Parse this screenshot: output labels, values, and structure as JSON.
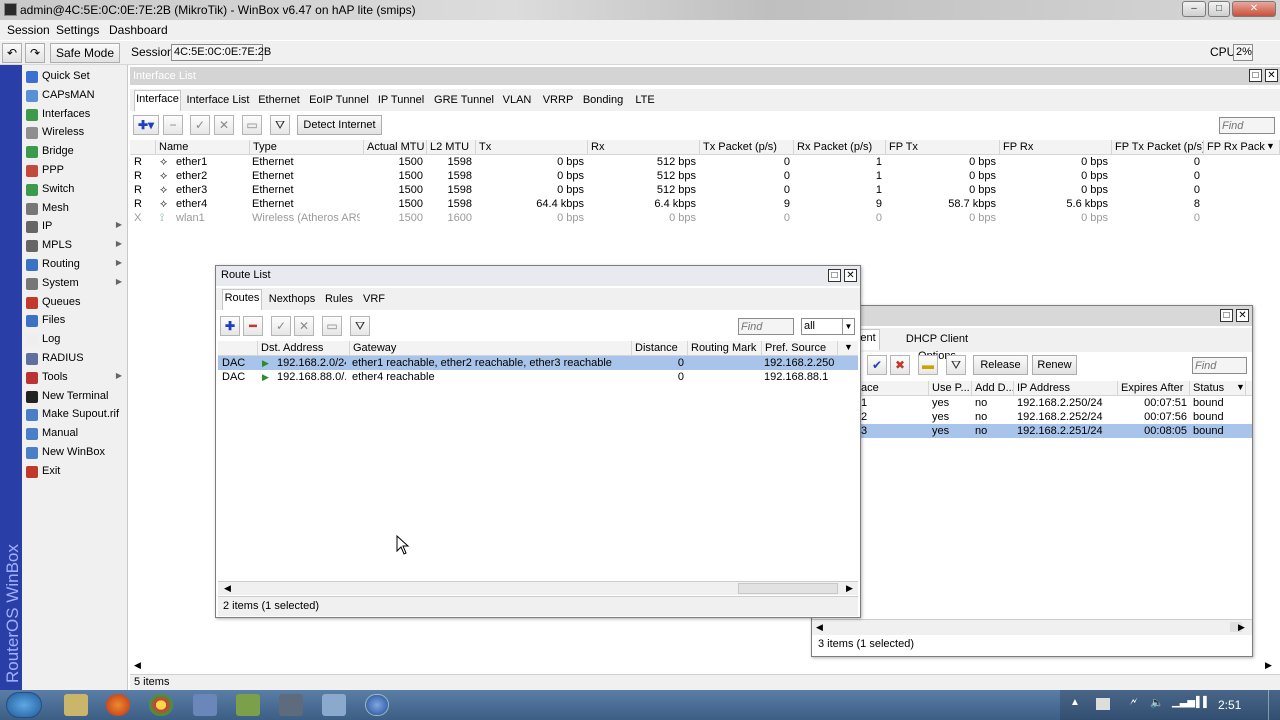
{
  "window": {
    "title": "admin@4C:5E:0C:0E:7E:2B (MikroTik) - WinBox v6.47 on hAP lite (smips)"
  },
  "menu": [
    "Session",
    "Settings",
    "Dashboard"
  ],
  "toolbar": {
    "safe_mode": "Safe Mode",
    "session_label": "Session:",
    "session_value": "4C:5E:0C:0E:7E:2B",
    "cpu_label": "CPU:",
    "cpu_value": "2%"
  },
  "strip_text": "RouterOS WinBox",
  "sidebar": [
    {
      "label": "Quick Set",
      "icon": "quickset-icon",
      "color": "#3b6fd4",
      "sub": false
    },
    {
      "label": "CAPsMAN",
      "icon": "capsman-icon",
      "color": "#5a8fd8",
      "sub": false
    },
    {
      "label": "Interfaces",
      "icon": "interfaces-icon",
      "color": "#3d9a4d",
      "sub": false
    },
    {
      "label": "Wireless",
      "icon": "wireless-icon",
      "color": "#8e8e8e",
      "sub": false
    },
    {
      "label": "Bridge",
      "icon": "bridge-icon",
      "color": "#3d9a4d",
      "sub": false
    },
    {
      "label": "PPP",
      "icon": "ppp-icon",
      "color": "#c24a3a",
      "sub": false
    },
    {
      "label": "Switch",
      "icon": "switch-icon",
      "color": "#3d9a4d",
      "sub": false
    },
    {
      "label": "Mesh",
      "icon": "mesh-icon",
      "color": "#777777",
      "sub": false
    },
    {
      "label": "IP",
      "icon": "ip-icon",
      "color": "#666666",
      "sub": true
    },
    {
      "label": "MPLS",
      "icon": "mpls-icon",
      "color": "#666666",
      "sub": true
    },
    {
      "label": "Routing",
      "icon": "routing-icon",
      "color": "#3a73c4",
      "sub": true
    },
    {
      "label": "System",
      "icon": "system-icon",
      "color": "#777777",
      "sub": true
    },
    {
      "label": "Queues",
      "icon": "queues-icon",
      "color": "#c0392b",
      "sub": false
    },
    {
      "label": "Files",
      "icon": "files-icon",
      "color": "#3a73c4",
      "sub": false
    },
    {
      "label": "Log",
      "icon": "log-icon",
      "color": "#eeeeee",
      "sub": false
    },
    {
      "label": "RADIUS",
      "icon": "radius-icon",
      "color": "#5e6fa0",
      "sub": false
    },
    {
      "label": "Tools",
      "icon": "tools-icon",
      "color": "#b33",
      "sub": true
    },
    {
      "label": "New Terminal",
      "icon": "terminal-icon",
      "color": "#222222",
      "sub": false
    },
    {
      "label": "Make Supout.rif",
      "icon": "supout-icon",
      "color": "#4a7fc8",
      "sub": false
    },
    {
      "label": "Manual",
      "icon": "manual-icon",
      "color": "#4a7fc8",
      "sub": false
    },
    {
      "label": "New WinBox",
      "icon": "winbox-icon",
      "color": "#4a7fc8",
      "sub": false
    },
    {
      "label": "Exit",
      "icon": "exit-icon",
      "color": "#c0392b",
      "sub": false
    }
  ],
  "interface_list": {
    "title": "Interface List",
    "tabs": [
      "Interface",
      "Interface List",
      "Ethernet",
      "EoIP Tunnel",
      "IP Tunnel",
      "GRE Tunnel",
      "VLAN",
      "VRRP",
      "Bonding",
      "LTE"
    ],
    "detect_internet": "Detect Internet",
    "find_placeholder": "Find",
    "columns": [
      "Name",
      "Type",
      "Actual MTU",
      "L2 MTU",
      "Tx",
      "Rx",
      "Tx Packet (p/s)",
      "Rx Packet (p/s)",
      "FP Tx",
      "FP Rx",
      "FP Tx Packet (p/s)",
      "FP Rx Pack"
    ],
    "rows": [
      {
        "flag": "R",
        "name": "ether1",
        "type": "Ethernet",
        "mtu": "1500",
        "l2mtu": "1598",
        "tx": "0 bps",
        "rx": "512 bps",
        "txp": "0",
        "rxp": "1",
        "fptx": "0 bps",
        "fprx": "0 bps",
        "fptxp": "0",
        "disabled": false
      },
      {
        "flag": "R",
        "name": "ether2",
        "type": "Ethernet",
        "mtu": "1500",
        "l2mtu": "1598",
        "tx": "0 bps",
        "rx": "512 bps",
        "txp": "0",
        "rxp": "1",
        "fptx": "0 bps",
        "fprx": "0 bps",
        "fptxp": "0",
        "disabled": false
      },
      {
        "flag": "R",
        "name": "ether3",
        "type": "Ethernet",
        "mtu": "1500",
        "l2mtu": "1598",
        "tx": "0 bps",
        "rx": "512 bps",
        "txp": "0",
        "rxp": "1",
        "fptx": "0 bps",
        "fprx": "0 bps",
        "fptxp": "0",
        "disabled": false
      },
      {
        "flag": "R",
        "name": "ether4",
        "type": "Ethernet",
        "mtu": "1500",
        "l2mtu": "1598",
        "tx": "64.4 kbps",
        "rx": "6.4 kbps",
        "txp": "9",
        "rxp": "9",
        "fptx": "58.7 kbps",
        "fprx": "5.6 kbps",
        "fptxp": "8",
        "disabled": false
      },
      {
        "flag": "X",
        "name": "wlan1",
        "type": "Wireless (Atheros AR9...",
        "mtu": "1500",
        "l2mtu": "1600",
        "tx": "0 bps",
        "rx": "0 bps",
        "txp": "0",
        "rxp": "0",
        "fptx": "0 bps",
        "fprx": "0 bps",
        "fptxp": "0",
        "disabled": true
      }
    ],
    "status": "5 items"
  },
  "route_list": {
    "title": "Route List",
    "tabs": [
      "Routes",
      "Nexthops",
      "Rules",
      "VRF"
    ],
    "find_placeholder": "Find",
    "filter_value": "all",
    "columns": [
      "Dst. Address",
      "Gateway",
      "Distance",
      "Routing Mark",
      "Pref. Source"
    ],
    "rows": [
      {
        "flag": "DAC",
        "dst": "192.168.2.0/24",
        "gateway": "ether1 reachable, ether2 reachable, ether3 reachable",
        "distance": "0",
        "mark": "",
        "pref": "192.168.2.250",
        "selected": true
      },
      {
        "flag": "DAC",
        "dst": "192.168.88.0/...",
        "gateway": "ether4 reachable",
        "distance": "0",
        "mark": "",
        "pref": "192.168.88.1",
        "selected": false
      }
    ],
    "status": "2 items (1 selected)"
  },
  "dhcp_client": {
    "tab_partial": "ent",
    "tab_options": "DHCP Client Options",
    "release": "Release",
    "renew": "Renew",
    "find_placeholder": "Find",
    "columns": [
      "ace",
      "Use P...",
      "Add D...",
      "IP Address",
      "Expires After",
      "Status"
    ],
    "rows": [
      {
        "iface": "1",
        "use_peer": "yes",
        "add_default": "no",
        "ip": "192.168.2.250/24",
        "expires": "00:07:51",
        "status": "bound",
        "selected": false
      },
      {
        "iface": "2",
        "use_peer": "yes",
        "add_default": "no",
        "ip": "192.168.2.252/24",
        "expires": "00:07:56",
        "status": "bound",
        "selected": false
      },
      {
        "iface": "3",
        "use_peer": "yes",
        "add_default": "no",
        "ip": "192.168.2.251/24",
        "expires": "00:08:05",
        "status": "bound",
        "selected": true
      }
    ],
    "status": "3 items (1 selected)"
  },
  "taskbar": {
    "clock": "2:51"
  },
  "colors": {
    "accent_blue": "#2a3ea8",
    "selected_row": "#a8c4ea"
  }
}
